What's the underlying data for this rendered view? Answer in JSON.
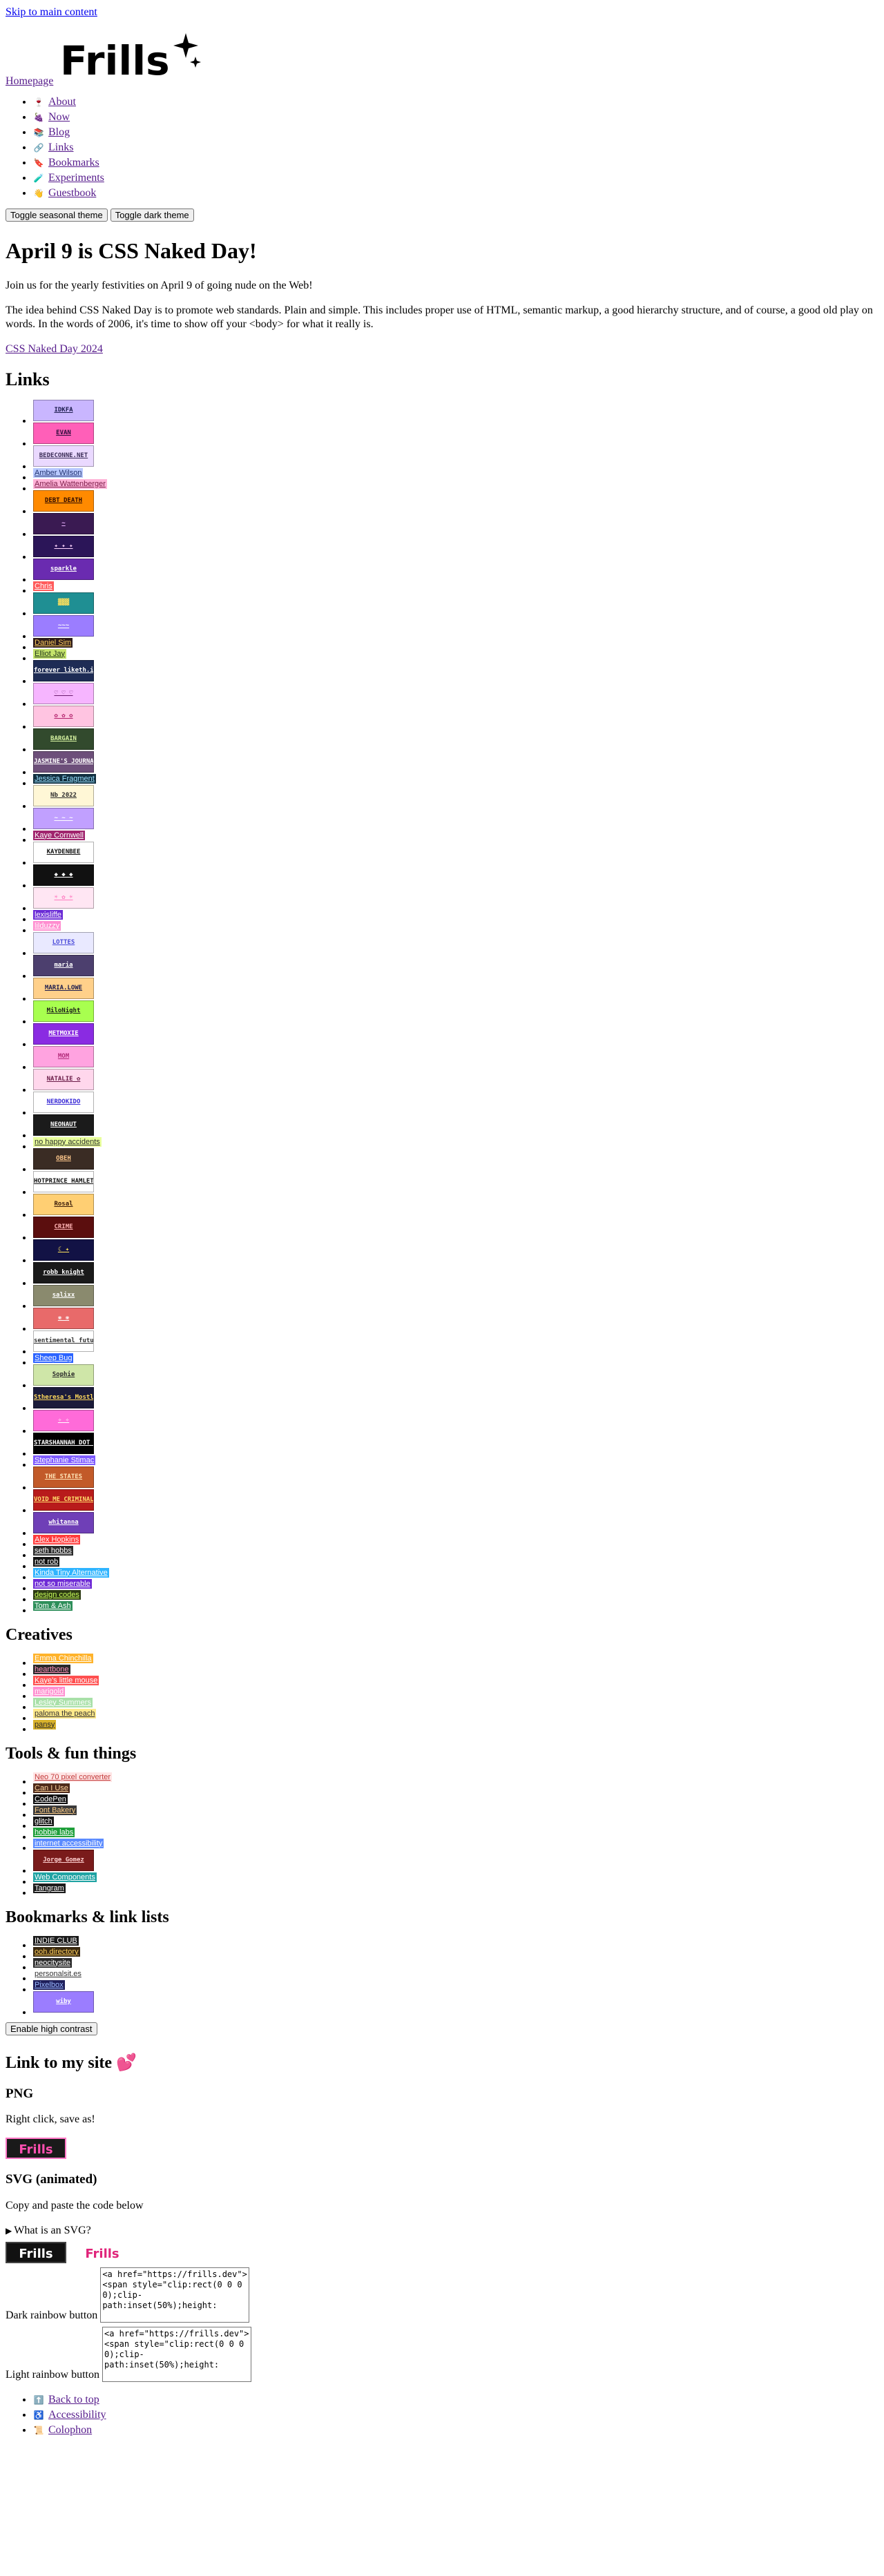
{
  "skip_link": "Skip to main content",
  "header": {
    "home_label": "Homepage",
    "logo_text": "Frills"
  },
  "nav": [
    {
      "emoji": "🍷",
      "label": "About"
    },
    {
      "emoji": "🍇",
      "label": "Now"
    },
    {
      "emoji": "📚",
      "label": "Blog"
    },
    {
      "emoji": "🔗",
      "label": "Links"
    },
    {
      "emoji": "🔖",
      "label": "Bookmarks"
    },
    {
      "emoji": "🧪",
      "label": "Experiments"
    },
    {
      "emoji": "👋",
      "label": "Guestbook"
    }
  ],
  "theme_buttons": {
    "seasonal": "Toggle seasonal theme",
    "dark": "Toggle dark theme"
  },
  "naked_day": {
    "title": "April 9 is CSS Naked Day!",
    "p1": "Join us for the yearly festivities on April 9 of going nude on the Web!",
    "p2": "The idea behind CSS Naked Day is to promote web standards. Plain and simple. This includes proper use of HTML, semantic markup, a good hierarchy structure, and of course, a good old play on words. In the words of 2006, it's time to show off your <body> for what it really is.",
    "link": "CSS Naked Day 2024"
  },
  "links_section": {
    "heading": "Links",
    "items": [
      {
        "type": "img",
        "text": "IDKFA",
        "bg": "#c9b6ff",
        "fg": "#1b1b4d"
      },
      {
        "type": "img",
        "text": "EVAN",
        "bg": "#ff5fb8",
        "fg": "#2a0a3a"
      },
      {
        "type": "img",
        "text": "BEDECONNE.NET",
        "bg": "#ead9ff",
        "fg": "#3a2c55"
      },
      {
        "type": "text",
        "text": "Amber Wilson",
        "bg": "#b7c8ff",
        "fg": "#20306b"
      },
      {
        "type": "text",
        "text": "Amelia Wattenberger",
        "bg": "#ffb2d7",
        "fg": "#7a1b47"
      },
      {
        "type": "img",
        "text": "DEBT DEATH",
        "bg": "#ff8a00",
        "fg": "#2a0800"
      },
      {
        "type": "img",
        "text": "~",
        "bg": "#3a1a52",
        "fg": "#e9b0ff"
      },
      {
        "type": "img",
        "text": "✦ ✦ ✦",
        "bg": "#2b1558",
        "fg": "#ffd6ff"
      },
      {
        "type": "img",
        "text": "sparkle",
        "bg": "#6a2bb0",
        "fg": "#ffffff"
      },
      {
        "type": "text",
        "text": "Chris",
        "bg": "#ff5b5b",
        "fg": "#ffffff"
      },
      {
        "type": "img",
        "text": "▓▓▓",
        "bg": "#1f8f93",
        "fg": "#ffe05c"
      },
      {
        "type": "img",
        "text": "~~~",
        "bg": "#9b7dff",
        "fg": "#ffffff"
      },
      {
        "type": "text",
        "text": "Daniel Sim",
        "bg": "#2d1b1b",
        "fg": "#ffcf5c"
      },
      {
        "type": "text",
        "text": "Elliot Jay",
        "bg": "#c4e36b",
        "fg": "#22361b"
      },
      {
        "type": "img",
        "text": "forever liketh.is",
        "bg": "#1e2c55",
        "fg": "#ffffff"
      },
      {
        "type": "img",
        "text": "♡ ♡ ♡",
        "bg": "#f6b5ff",
        "fg": "#6a1b6e"
      },
      {
        "type": "img",
        "text": "✿ ✿ ✿",
        "bg": "#ffc4e1",
        "fg": "#b3246d"
      },
      {
        "type": "img",
        "text": "BARGAIN",
        "bg": "#324a2d",
        "fg": "#d5f2a0"
      },
      {
        "type": "img",
        "text": "JASMINE'S JOURNAL",
        "bg": "#6d4f7a",
        "fg": "#ffffff"
      },
      {
        "type": "text",
        "text": "Jessica Fragment",
        "bg": "#123040",
        "fg": "#9be1ff"
      },
      {
        "type": "img",
        "text": "Nb 2022",
        "bg": "#fff7d6",
        "fg": "#2b2b2b"
      },
      {
        "type": "img",
        "text": "~ ~ ~",
        "bg": "#c1a0ff",
        "fg": "#ffffff"
      },
      {
        "type": "text",
        "text": "Kaye Cornwell",
        "bg": "#a0246d",
        "fg": "#ffffff"
      },
      {
        "type": "img",
        "text": "KAYDENBEE",
        "bg": "#ffffff",
        "fg": "#111111"
      },
      {
        "type": "img",
        "text": "◆ ◆ ◆",
        "bg": "#111111",
        "fg": "#ffffff"
      },
      {
        "type": "img",
        "text": "☀ ✿ ☀",
        "bg": "#ffe6f3",
        "fg": "#ff7bc0"
      },
      {
        "type": "text",
        "text": "lexisliffe",
        "bg": "#6b2bd6",
        "fg": "#ffffff"
      },
      {
        "type": "text",
        "text": "lilduzzy",
        "bg": "#ff8ed0",
        "fg": "#ffffff"
      },
      {
        "type": "img",
        "text": "LOTTES",
        "bg": "#e9e9ff",
        "fg": "#4a4ad9"
      },
      {
        "type": "img",
        "text": "maria",
        "bg": "#4c3f6e",
        "fg": "#ffffff"
      },
      {
        "type": "img",
        "text": "MARIA.LOWE",
        "bg": "#ffd08a",
        "fg": "#1b1b4d"
      },
      {
        "type": "img",
        "text": "MiloNight",
        "bg": "#a8ff4f",
        "fg": "#1a1a1a"
      },
      {
        "type": "img",
        "text": "METMOXIE",
        "bg": "#8a2be2",
        "fg": "#ffffff"
      },
      {
        "type": "img",
        "text": "MOM",
        "bg": "#ffa3e0",
        "fg": "#b22b7a"
      },
      {
        "type": "img",
        "text": "NATALIE ✿",
        "bg": "#ffd7ec",
        "fg": "#6a1b47"
      },
      {
        "type": "img",
        "text": "NERDOKIDO",
        "bg": "#ffffff",
        "fg": "#3a2bd6"
      },
      {
        "type": "img",
        "text": "NEONAUT",
        "bg": "#1b1b1b",
        "fg": "#ffffff"
      },
      {
        "type": "text",
        "text": "no happy accidents",
        "bg": "#e8ff9b",
        "fg": "#2a2a2a"
      },
      {
        "type": "img",
        "text": "ОВЕН",
        "bg": "#3a2c24",
        "fg": "#ffc88c"
      },
      {
        "type": "img",
        "text": "HOTPRINCE HAMLET",
        "bg": "#ffffff",
        "fg": "#111111"
      },
      {
        "type": "img",
        "text": "Rosal",
        "bg": "#ffcf73",
        "fg": "#3a1b0a"
      },
      {
        "type": "img",
        "text": "CRIME",
        "bg": "#5b0e0e",
        "fg": "#ffb3b3"
      },
      {
        "type": "img",
        "text": "☾ ✦",
        "bg": "#121245",
        "fg": "#ffe45c"
      },
      {
        "type": "img",
        "text": "robb knight",
        "bg": "#1a1a1a",
        "fg": "#ffffff"
      },
      {
        "type": "img",
        "text": "salixx",
        "bg": "#8a8a6e",
        "fg": "#ffffff"
      },
      {
        "type": "img",
        "text": "❀ ❀",
        "bg": "#e86a6a",
        "fg": "#ffffff"
      },
      {
        "type": "img",
        "text": "sentimental futurist ♡",
        "bg": "#ffffff",
        "fg": "#333333"
      },
      {
        "type": "text",
        "text": "Sheep Bug",
        "bg": "#2b63ff",
        "fg": "#ffffff"
      },
      {
        "type": "img",
        "text": "Sophie",
        "bg": "#cfe6a8",
        "fg": "#2a2a2a"
      },
      {
        "type": "img",
        "text": "Stheresa's Mostly",
        "bg": "#1b1b3a",
        "fg": "#ffd95c"
      },
      {
        "type": "img",
        "text": "✧ ✧",
        "bg": "#ff6bd9",
        "fg": "#ffffff"
      },
      {
        "type": "img",
        "text": "STARSHANNAH DOT ORG",
        "bg": "#000000",
        "fg": "#ffffff"
      },
      {
        "type": "text",
        "text": "Stephanie Stimac",
        "bg": "#7e5bff",
        "fg": "#ffffff"
      },
      {
        "type": "img",
        "text": "THE STATES",
        "bg": "#c25a29",
        "fg": "#ffe3b5"
      },
      {
        "type": "img",
        "text": "VOID ME CRIMINAL",
        "bg": "#b81b1b",
        "fg": "#ffdd6b"
      },
      {
        "type": "img",
        "text": "whitanna",
        "bg": "#6f3fb7",
        "fg": "#ffffff"
      },
      {
        "type": "text",
        "text": "Alex Hopkins",
        "bg": "#ff3b3b",
        "fg": "#ffffff"
      },
      {
        "type": "text",
        "text": "seth hobbs",
        "bg": "#2b2b2b",
        "fg": "#ffffff"
      },
      {
        "type": "text",
        "text": "not rob",
        "bg": "#141414",
        "fg": "#ffffff"
      },
      {
        "type": "text",
        "text": "Kinda Tiny Alternative",
        "bg": "#2fb4ff",
        "fg": "#ffffff"
      },
      {
        "type": "text",
        "text": "not so miserable",
        "bg": "#6f2bd6",
        "fg": "#ffffff"
      },
      {
        "type": "text",
        "text": "design codes",
        "bg": "#2c3a12",
        "fg": "#c9ff5b"
      },
      {
        "type": "text",
        "text": "Tom & Ash",
        "bg": "#2e8f5a",
        "fg": "#ffffff"
      }
    ]
  },
  "creatives_section": {
    "heading": "Creatives",
    "items": [
      {
        "type": "text",
        "text": "Emma Chinchilla",
        "bg": "#ffb32b",
        "fg": "#ffffff"
      },
      {
        "type": "text",
        "text": "heartbone",
        "bg": "#2a2a2a",
        "fg": "#ff8fb8"
      },
      {
        "type": "text",
        "text": "Kaye's little mouse",
        "bg": "#ff4f4f",
        "fg": "#ffffff"
      },
      {
        "type": "text",
        "text": "marigold",
        "bg": "#ff8fd0",
        "fg": "#ffffff"
      },
      {
        "type": "text",
        "text": "Lesley Summers",
        "bg": "#a8e0a8",
        "fg": "#ffffff"
      },
      {
        "type": "text",
        "text": "paloma the peach",
        "bg": "#ffe98a",
        "fg": "#333333"
      },
      {
        "type": "text",
        "text": "pansy",
        "bg": "#d9b22b",
        "fg": "#2a2a2a"
      }
    ]
  },
  "tools_section": {
    "heading": "Tools & fun things",
    "items": [
      {
        "type": "text",
        "text": "Neo 70 pixel converter",
        "bg": "#ffe5e5",
        "fg": "#c23a3a"
      },
      {
        "type": "text",
        "text": "Can I Use",
        "bg": "#4d2a1a",
        "fg": "#ffd5a0"
      },
      {
        "type": "text",
        "text": "CodePen",
        "bg": "#111111",
        "fg": "#ffffff"
      },
      {
        "type": "text",
        "text": "Font Bakery",
        "bg": "#3a3a3a",
        "fg": "#ffcf8a"
      },
      {
        "type": "text",
        "text": "glitch",
        "bg": "#1a1a1a",
        "fg": "#ffffff"
      },
      {
        "type": "text",
        "text": "hobbie labs",
        "bg": "#1f9f3a",
        "fg": "#ffffff"
      },
      {
        "type": "text",
        "text": "internet accessibility",
        "bg": "#5b8bff",
        "fg": "#ffffff"
      },
      {
        "type": "img",
        "text": "Jorge Gomez",
        "bg": "#7a1b1b",
        "fg": "#ffd0d0"
      },
      {
        "type": "text",
        "text": "Web Components",
        "bg": "#1fa3a3",
        "fg": "#ffffff"
      },
      {
        "type": "text",
        "text": "Tangram",
        "bg": "#1b1b1b",
        "fg": "#ffffff"
      }
    ]
  },
  "bookmarks_section": {
    "heading": "Bookmarks & link lists",
    "items": [
      {
        "type": "text",
        "text": "INDIE CLUB",
        "bg": "#1b1b1b",
        "fg": "#ffffff"
      },
      {
        "type": "text",
        "text": "ooh.directory",
        "bg": "#3a2a12",
        "fg": "#ffcf5c"
      },
      {
        "type": "text",
        "text": "neocitysite",
        "bg": "#2b2b2b",
        "fg": "#ffffff"
      },
      {
        "type": "text",
        "text": "personalsit.es",
        "bg": "#ffffff",
        "fg": "#333333"
      },
      {
        "type": "text",
        "text": "Pixelbox",
        "bg": "#1f1f5b",
        "fg": "#9bbaff"
      },
      {
        "type": "img",
        "text": "wiby",
        "bg": "#9b7dff",
        "fg": "#ffffff"
      }
    ]
  },
  "contrast_button": "Enable high contrast",
  "link_to_site": {
    "heading": "Link to my site",
    "png_heading": "PNG",
    "png_note": "Right click, save as!",
    "badge_text": "Frills",
    "svg_heading": "SVG (animated)",
    "svg_note": "Copy and paste the code below",
    "svg_summary": "What is an SVG?",
    "dark_label": "Dark rainbow button",
    "dark_code": "<a href=\"https://frills.dev\"><span style=\"clip:rect(0 0 0 0);clip-path:inset(50%);height:",
    "light_label": "Light rainbow button",
    "light_code": "<a href=\"https://frills.dev\"><span style=\"clip:rect(0 0 0 0);clip-path:inset(50%);height:"
  },
  "footer": [
    {
      "emoji": "⬆️",
      "label": "Back to top"
    },
    {
      "emoji": "♿",
      "label": "Accessibility"
    },
    {
      "emoji": "📜",
      "label": "Colophon"
    }
  ]
}
